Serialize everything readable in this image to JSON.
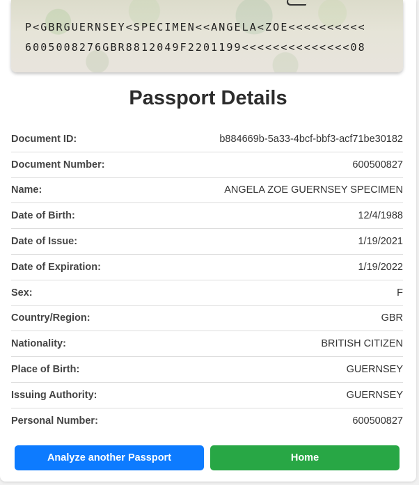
{
  "passport_image": {
    "mrz_line1": "P<GBRGUERNSEY<SPECIMEN<<ANGELA<ZOE<<<<<<<<<<",
    "mrz_line2": "6005008276GBR8812049F2201199<<<<<<<<<<<<<<08"
  },
  "title": "Passport Details",
  "details": [
    {
      "label": "Document ID:",
      "value": "b884669b-5a33-4bcf-bbf3-acf71be30182"
    },
    {
      "label": "Document Number:",
      "value": "600500827"
    },
    {
      "label": "Name:",
      "value": "ANGELA ZOE GUERNSEY SPECIMEN"
    },
    {
      "label": "Date of Birth:",
      "value": "12/4/1988"
    },
    {
      "label": "Date of Issue:",
      "value": "1/19/2021"
    },
    {
      "label": "Date of Expiration:",
      "value": "1/19/2022"
    },
    {
      "label": "Sex:",
      "value": "F"
    },
    {
      "label": "Country/Region:",
      "value": "GBR"
    },
    {
      "label": "Nationality:",
      "value": "BRITISH CITIZEN"
    },
    {
      "label": "Place of Birth:",
      "value": "GUERNSEY"
    },
    {
      "label": "Issuing Authority:",
      "value": "GUERNSEY"
    },
    {
      "label": "Personal Number:",
      "value": "600500827"
    }
  ],
  "buttons": {
    "analyze_label": "Analyze another Passport",
    "home_label": "Home"
  },
  "colors": {
    "analyze_button": "#0d7bff",
    "home_button": "#28a745"
  }
}
